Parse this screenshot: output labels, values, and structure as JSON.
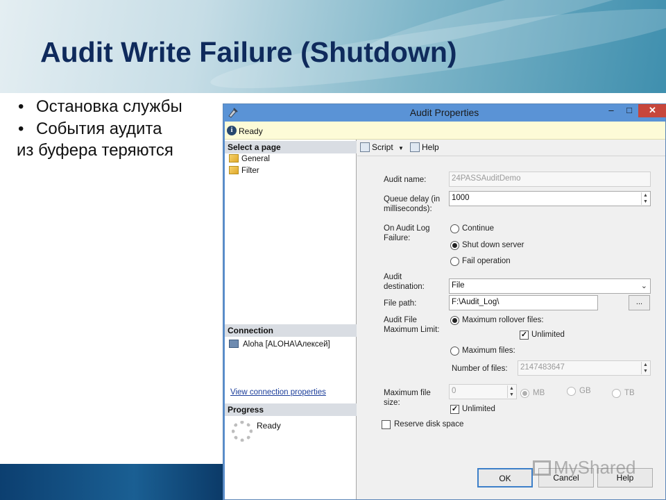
{
  "slide": {
    "title": "Audit Write Failure (Shutdown)",
    "bullets": [
      "Остановка службы",
      "События аудита"
    ],
    "continuation": "из буфера теряются"
  },
  "dialog": {
    "title": "Audit Properties",
    "status": "Ready",
    "window_controls": {
      "minimize": "–",
      "maximize": "□",
      "close": "✕"
    },
    "left": {
      "select_header": "Select a page",
      "pages": [
        "General",
        "Filter"
      ],
      "connection_header": "Connection",
      "connection": "Aloha [ALOHA\\Алексей]",
      "connection_link": "View connection properties",
      "progress_header": "Progress",
      "progress_status": "Ready"
    },
    "toolbar": {
      "script": "Script",
      "help": "Help"
    },
    "form": {
      "audit_name_label": "Audit name:",
      "audit_name": "24PASSAuditDemo",
      "queue_delay_label_1": "Queue delay (in",
      "queue_delay_label_2": "milliseconds):",
      "queue_delay": "1000",
      "on_failure_label_1": "On Audit Log",
      "on_failure_label_2": "Failure:",
      "on_failure_options": [
        "Continue",
        "Shut down server",
        "Fail operation"
      ],
      "on_failure_selected": "Shut down server",
      "destination_label_1": "Audit",
      "destination_label_2": "destination:",
      "destination": "File",
      "file_path_label": "File path:",
      "file_path": "F:\\Audit_Log\\",
      "browse": "...",
      "max_limit_label_1": "Audit File",
      "max_limit_label_2": "Maximum Limit:",
      "max_rollover": "Maximum rollover files:",
      "unlimited": "Unlimited",
      "max_files": "Maximum files:",
      "num_files_label": "Number of files:",
      "num_files": "2147483647",
      "max_size_label_1": "Maximum file",
      "max_size_label_2": "size:",
      "max_size": "0",
      "units": [
        "MB",
        "GB",
        "TB"
      ],
      "size_unlimited": "Unlimited",
      "reserve_disk": "Reserve disk space"
    },
    "buttons": {
      "ok": "OK",
      "cancel": "Cancel",
      "help": "Help"
    }
  },
  "watermark": "MyShared"
}
